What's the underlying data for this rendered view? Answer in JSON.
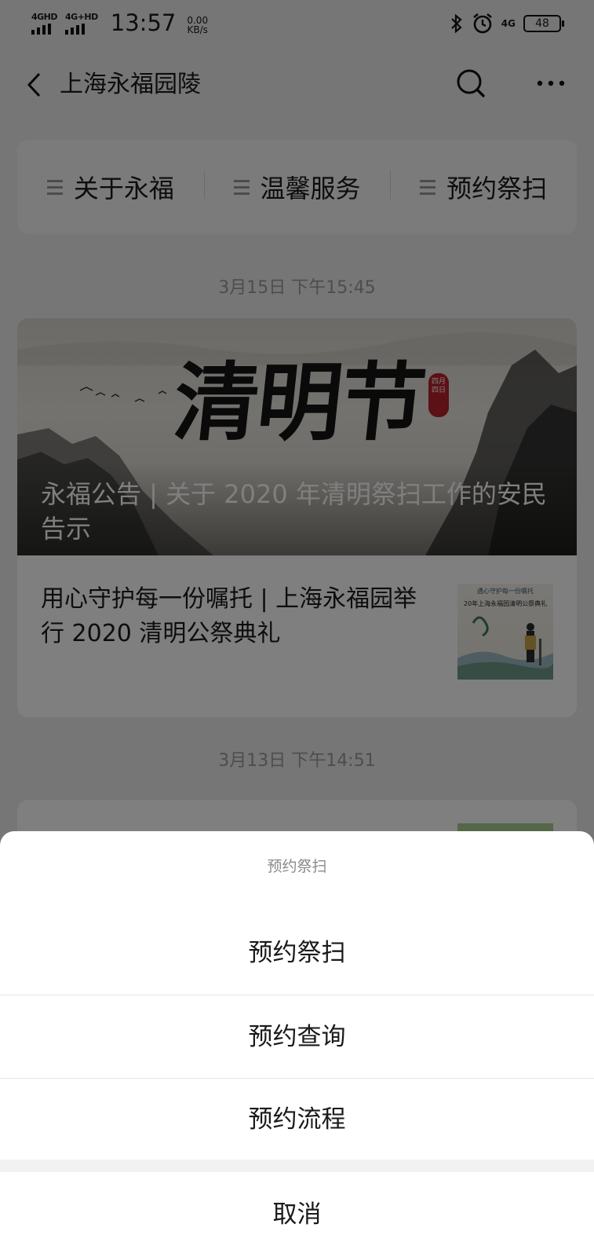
{
  "status_bar": {
    "signal1_label": "4GHD",
    "signal2_label": "4G+HD",
    "time": "13:57",
    "speed_value": "0.00",
    "speed_unit": "KB/s",
    "network_label": "4G",
    "battery": "48"
  },
  "nav": {
    "title": "上海永福园陵",
    "back_icon": "chevron-left-icon",
    "search_icon": "search-icon",
    "more_icon": "more-dots-icon"
  },
  "menu": {
    "items": [
      {
        "label": "关于永福"
      },
      {
        "label": "温馨服务"
      },
      {
        "label": "预约祭扫"
      }
    ]
  },
  "feed": [
    {
      "date": "3月15日 下午15:45",
      "cover": {
        "calligraphy": "清明节",
        "seal_text": "四月四日",
        "title": "永福公告 | 关于 2020 年清明祭扫工作的安民告示"
      },
      "sub_article": {
        "title": "用心守护每一份嘱托 | 上海永福园举行 2020 清明公祭典礼",
        "thumb_caption_top": "遇心守护每一份嘱托",
        "thumb_caption": "20年上海永福园清明公祭典礼"
      }
    },
    {
      "date": "3月13日 下午14:51"
    }
  ],
  "action_sheet": {
    "title": "预约祭扫",
    "options": [
      {
        "label": "预约祭扫"
      },
      {
        "label": "预约查询"
      },
      {
        "label": "预约流程"
      }
    ],
    "cancel": "取消"
  }
}
